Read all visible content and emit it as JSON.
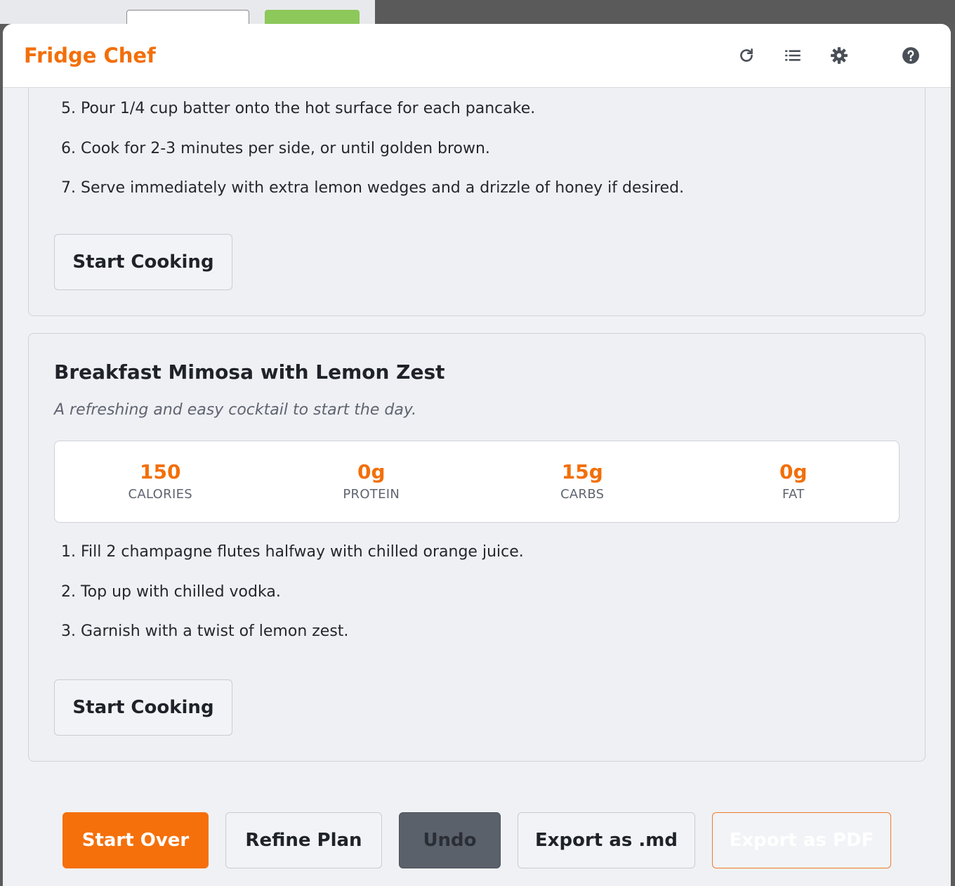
{
  "app": {
    "title": "Fridge Chef"
  },
  "header_icons": [
    "refresh-icon",
    "list-icon",
    "gear-icon",
    "help-icon"
  ],
  "colors": {
    "accent": "#f26f09",
    "card_bg": "#eff0f4",
    "undo_bg": "#5b616b"
  },
  "recipe1": {
    "steps": [
      "5. Pour 1/4 cup batter onto the hot surface for each pancake.",
      "6. Cook for 2-3 minutes per side, or until golden brown.",
      "7. Serve immediately with extra lemon wedges and a drizzle of honey if desired."
    ],
    "start_label": "Start Cooking"
  },
  "recipe2": {
    "title": "Breakfast Mimosa with Lemon Zest",
    "description": "A refreshing and easy cocktail to start the day.",
    "nutrition": [
      {
        "value": "150",
        "label": "CALORIES"
      },
      {
        "value": "0g",
        "label": "PROTEIN"
      },
      {
        "value": "15g",
        "label": "CARBS"
      },
      {
        "value": "0g",
        "label": "FAT"
      }
    ],
    "steps": [
      "1. Fill 2 champagne flutes halfway with chilled orange juice.",
      "2. Top up with chilled vodka.",
      "3. Garnish with a twist of lemon zest."
    ],
    "start_label": "Start Cooking"
  },
  "footer": {
    "start_over": "Start Over",
    "refine": "Refine Plan",
    "undo": "Undo",
    "export_md": "Export as .md",
    "export_pdf": "Export as PDF"
  }
}
